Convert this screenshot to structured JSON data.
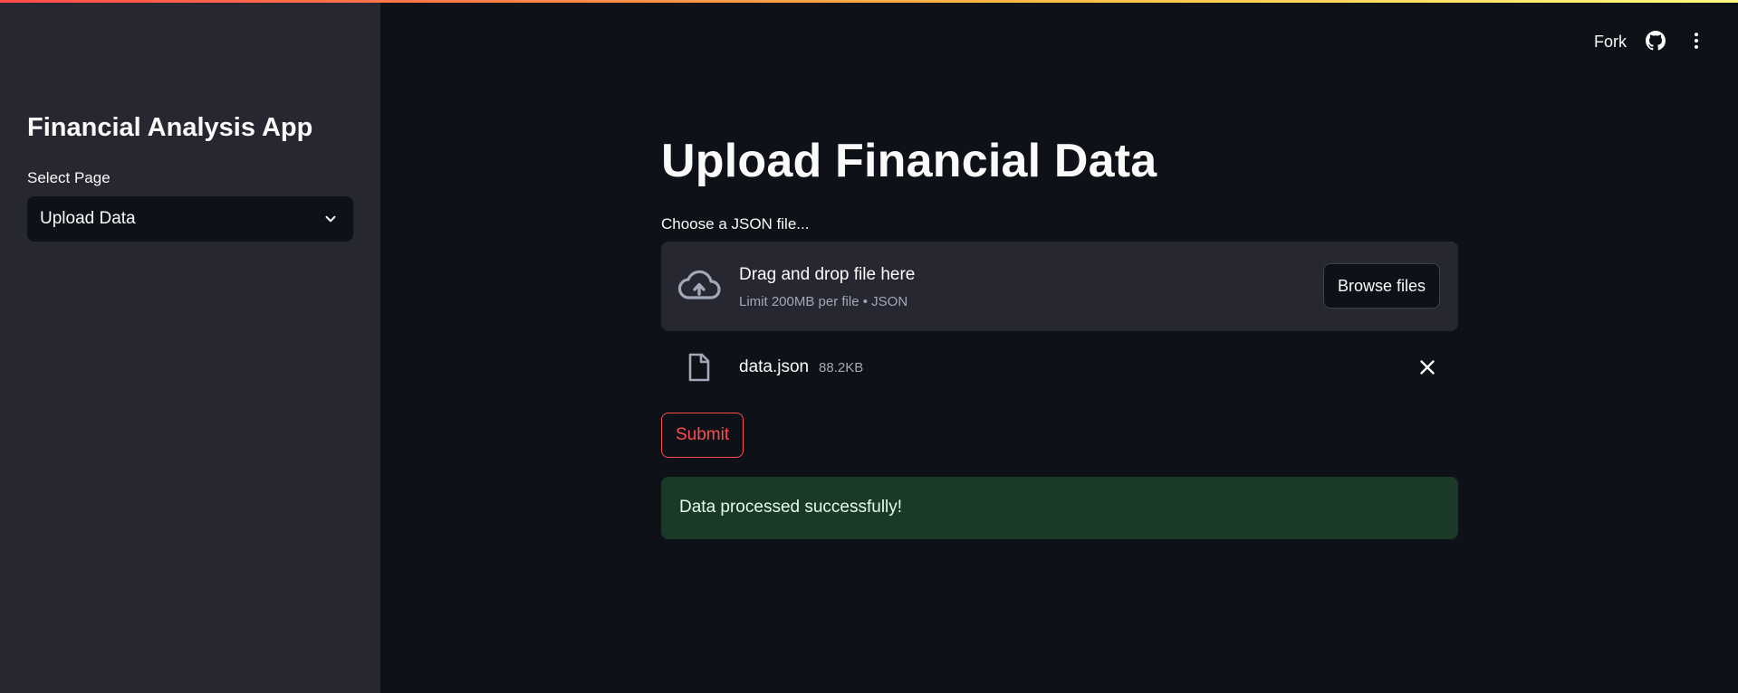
{
  "app": {
    "accent_gradient": [
      "#ff4b4b",
      "#ffbd45",
      "#fffd80"
    ]
  },
  "sidebar": {
    "title": "Financial Analysis App",
    "select_label": "Select Page",
    "select_value": "Upload Data",
    "select_icon": "chevron-down-icon"
  },
  "header": {
    "fork_label": "Fork",
    "github_icon": "github-icon",
    "menu_icon": "kebab-menu-icon"
  },
  "main": {
    "title": "Upload Financial Data",
    "uploader": {
      "label": "Choose a JSON file...",
      "drop_title": "Drag and drop file here",
      "drop_subtitle": "Limit 200MB per file • JSON",
      "browse_label": "Browse files",
      "icon": "cloud-upload-icon"
    },
    "uploaded_file": {
      "name": "data.json",
      "size": "88.2KB",
      "icon": "file-icon",
      "remove_icon": "close-icon"
    },
    "submit_label": "Submit",
    "success_message": "Data processed successfully!"
  },
  "colors": {
    "background": "#0e1117",
    "sidebar": "#262730",
    "primary": "#ff4b4b",
    "success_bg": "#1b3927",
    "success_text": "#dffde9"
  }
}
